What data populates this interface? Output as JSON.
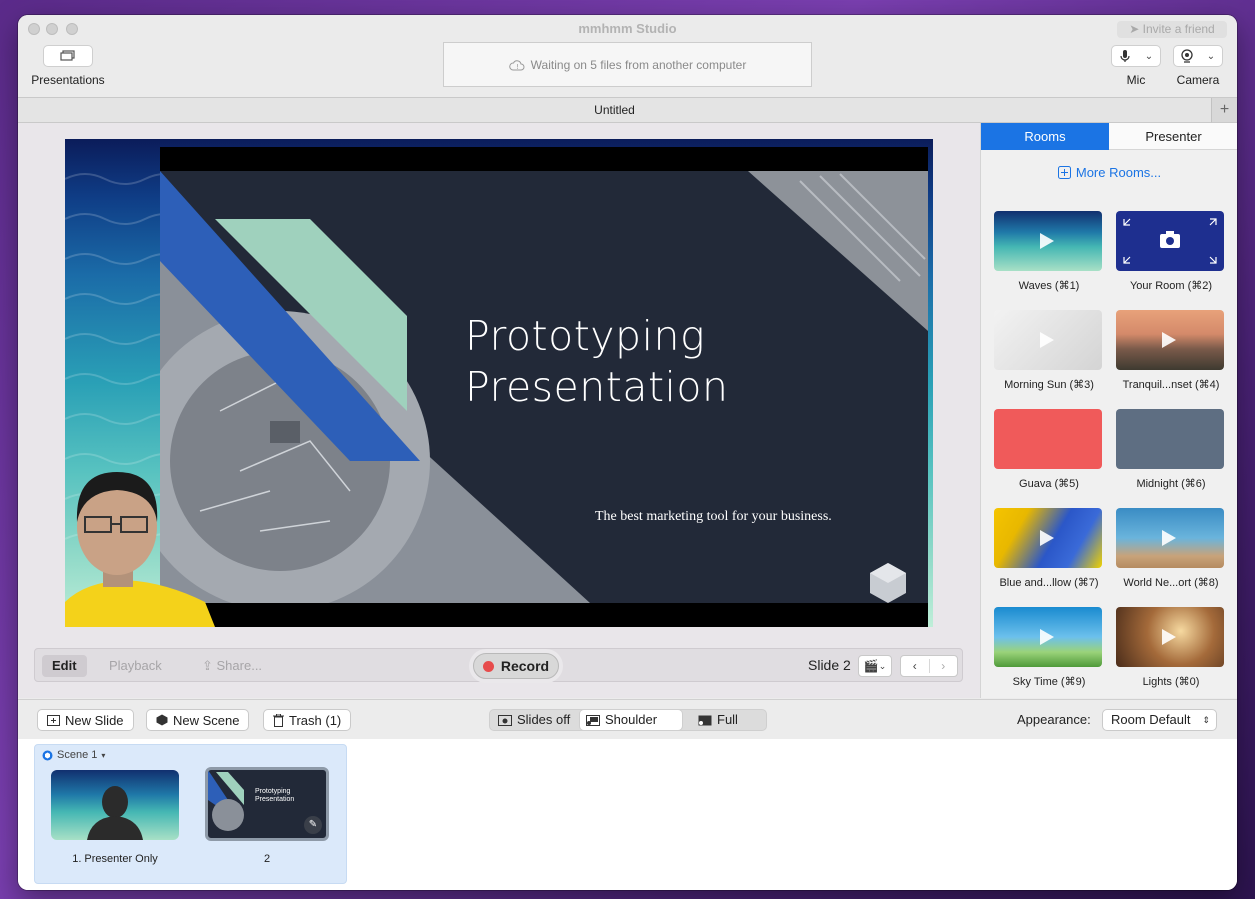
{
  "window": {
    "title": "mmhmm Studio",
    "invite_label": "Invite a friend"
  },
  "toolbar": {
    "presentations_label": "Presentations",
    "status_text": "Waiting on 5 files from another computer",
    "mic_label": "Mic",
    "camera_label": "Camera"
  },
  "document": {
    "tab_title": "Untitled",
    "add_tab": "+"
  },
  "slide": {
    "title_line1": "Prototyping",
    "title_line2": "Presentation",
    "subtitle": "The best marketing tool for your business."
  },
  "controls": {
    "edit": "Edit",
    "playback": "Playback",
    "share": "Share...",
    "record": "Record",
    "slide_indicator": "Slide 2"
  },
  "panel": {
    "tabs": [
      {
        "label": "Rooms",
        "active": true
      },
      {
        "label": "Presenter",
        "active": false
      }
    ],
    "more_rooms": "More Rooms...",
    "rooms": [
      {
        "label": "Waves (⌘1)",
        "style": "waves"
      },
      {
        "label": "Your Room (⌘2)",
        "style": "yourroom"
      },
      {
        "label": "Morning Sun (⌘3)",
        "style": "morning"
      },
      {
        "label": "Tranquil...nset (⌘4)",
        "style": "tranquil"
      },
      {
        "label": "Guava (⌘5)",
        "style": "guava"
      },
      {
        "label": "Midnight (⌘6)",
        "style": "midnight"
      },
      {
        "label": "Blue and...llow (⌘7)",
        "style": "blueyellow"
      },
      {
        "label": "World Ne...ort (⌘8)",
        "style": "world"
      },
      {
        "label": "Sky Time (⌘9)",
        "style": "sky"
      },
      {
        "label": "Lights (⌘0)",
        "style": "lights"
      }
    ]
  },
  "bottom": {
    "new_slide": "New Slide",
    "new_scene": "New Scene",
    "trash": "Trash (1)",
    "layouts": [
      {
        "label": "Slides off",
        "active": false
      },
      {
        "label": "Shoulder",
        "active": true
      },
      {
        "label": "Full",
        "active": false
      }
    ],
    "appearance_label": "Appearance:",
    "appearance_value": "Room Default"
  },
  "scenes": {
    "scene_name": "Scene 1",
    "slides": [
      {
        "label": "1. Presenter Only"
      },
      {
        "label": "2",
        "mini_title_1": "Prototyping",
        "mini_title_2": "Presentation"
      }
    ]
  },
  "colors": {
    "accent": "#1b74e4",
    "record": "#e74c4c",
    "guava": "#f05a5a",
    "midnight": "#5e6e82"
  }
}
